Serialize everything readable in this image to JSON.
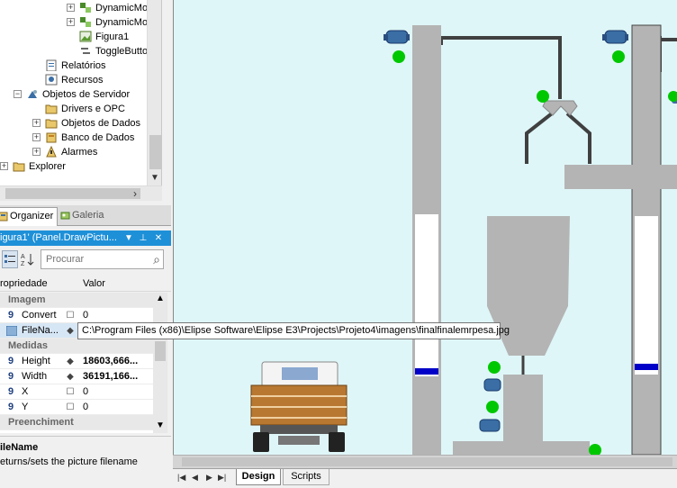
{
  "tree": {
    "items": [
      {
        "label": "DynamicMo",
        "icon": "dynamic-icon",
        "expander": "+"
      },
      {
        "label": "DynamicMo",
        "icon": "dynamic-icon",
        "expander": "+"
      },
      {
        "label": "Figura1",
        "icon": "picture-icon",
        "expander": ""
      },
      {
        "label": "ToggleButto",
        "icon": "toggle-icon",
        "expander": ""
      },
      {
        "label": "Relatórios",
        "icon": "reports-icon",
        "expander": ""
      },
      {
        "label": "Recursos",
        "icon": "resources-icon",
        "expander": ""
      },
      {
        "label": "Objetos de Servidor",
        "icon": "server-objects-icon",
        "expander": "−"
      },
      {
        "label": "Drivers e OPC",
        "icon": "folder-icon",
        "expander": ""
      },
      {
        "label": "Objetos de Dados",
        "icon": "folder-icon",
        "expander": "+"
      },
      {
        "label": "Banco de Dados",
        "icon": "database-icon",
        "expander": "+"
      },
      {
        "label": "Alarmes",
        "icon": "alarm-icon",
        "expander": "+"
      },
      {
        "label": "Explorer",
        "icon": "folder-icon",
        "expander": "+"
      }
    ]
  },
  "tabs": {
    "organizer": "Organizer",
    "galeria": "Galeria"
  },
  "properties": {
    "title": "igura1' (Panel.DrawPictu...",
    "pin": "⊥",
    "close": "✕",
    "dropdown": "▼",
    "search_placeholder": "Procurar",
    "col_property": "ropriedade",
    "col_value": "Valor",
    "rows": [
      {
        "kind": "category",
        "name": "Imagem"
      },
      {
        "kind": "prop",
        "num": "9",
        "name": "Convert",
        "mark": "☐",
        "value": "0",
        "bold": false
      },
      {
        "kind": "prop",
        "num": "",
        "name": "FileNa...",
        "mark": "◆",
        "value": "",
        "bold": false,
        "selected": true
      },
      {
        "kind": "category",
        "name": "Medidas"
      },
      {
        "kind": "prop",
        "num": "9",
        "name": "Height",
        "mark": "◆",
        "value": "18603,666...",
        "bold": true
      },
      {
        "kind": "prop",
        "num": "9",
        "name": "Width",
        "mark": "◆",
        "value": "36191,166...",
        "bold": true
      },
      {
        "kind": "prop",
        "num": "9",
        "name": "X",
        "mark": "☐",
        "value": "0",
        "bold": false
      },
      {
        "kind": "prop",
        "num": "9",
        "name": "Y",
        "mark": "☐",
        "value": "0",
        "bold": false
      },
      {
        "kind": "category",
        "name": "Preenchiment"
      }
    ],
    "tooltip": "C:\\Program Files (x86)\\Elipse Software\\Elipse E3\\Projects\\Projeto4\\imagens\\finalfinalemrpesa.jpg"
  },
  "description": {
    "name": "ileName",
    "text": "eturns/sets the picture filename"
  },
  "bottom_tabs": {
    "design": "Design",
    "scripts": "Scripts"
  },
  "colors": {
    "canvas_bg": "#dff6f8",
    "tank_gray": "#b4b4b4",
    "level_blue": "#0000c8",
    "indicator_green": "#00c800",
    "pump_blue": "#3a6ea5",
    "pipe": "#404040",
    "title_bar": "#1e90d8"
  }
}
